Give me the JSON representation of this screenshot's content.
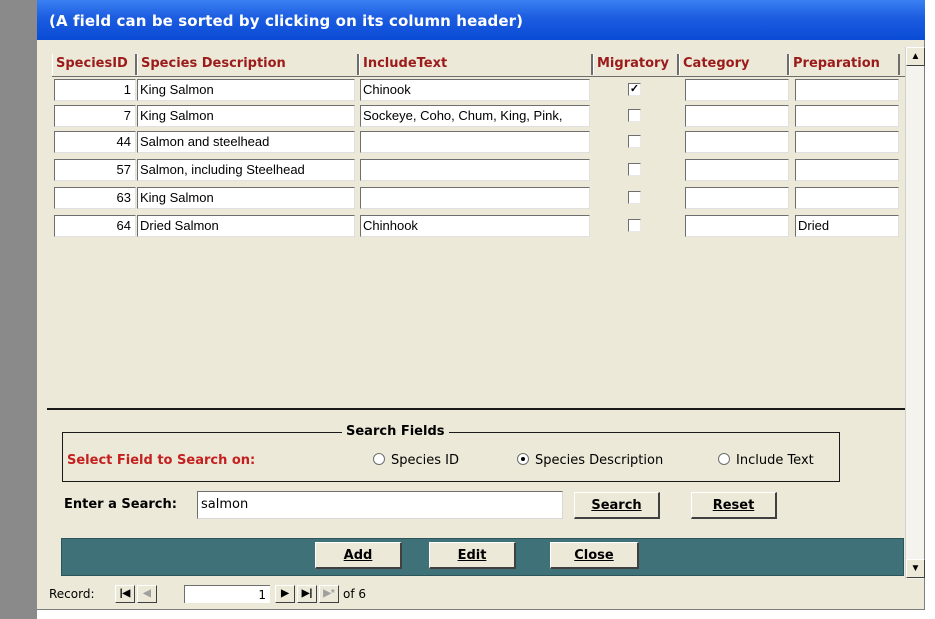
{
  "title": "(A field can be sorted by clicking on its column header)",
  "columns": [
    "SpeciesID",
    "Species Description",
    "IncludeText",
    "Migratory",
    "Category",
    "Preparation"
  ],
  "rows": [
    {
      "id": "1",
      "description": "King Salmon",
      "include": "Chinook",
      "migratory": true,
      "category": "",
      "preparation": ""
    },
    {
      "id": "7",
      "description": "King Salmon",
      "include": "Sockeye, Coho, Chum, King, Pink,",
      "migratory": false,
      "category": "",
      "preparation": ""
    },
    {
      "id": "44",
      "description": "Salmon and steelhead",
      "include": "",
      "migratory": false,
      "category": "",
      "preparation": ""
    },
    {
      "id": "57",
      "description": "Salmon, including Steelhead",
      "include": "",
      "migratory": false,
      "category": "",
      "preparation": ""
    },
    {
      "id": "63",
      "description": "King Salmon",
      "include": "",
      "migratory": false,
      "category": "",
      "preparation": ""
    },
    {
      "id": "64",
      "description": "Dried Salmon",
      "include": "Chinhook",
      "migratory": false,
      "category": "",
      "preparation": "Dried"
    }
  ],
  "search": {
    "legend": "Search Fields",
    "select_label": "Select Field to Search on:",
    "options": [
      {
        "label": "Species ID",
        "selected": false
      },
      {
        "label": "Species Description",
        "selected": true
      },
      {
        "label": "Include Text",
        "selected": false
      }
    ],
    "enter_label": "Enter a Search:",
    "value": "salmon",
    "search_button": "Search",
    "reset_button": "Reset"
  },
  "actions": {
    "add": "Add",
    "edit": "Edit",
    "close": "Close"
  },
  "record_nav": {
    "label": "Record:",
    "current": "1",
    "of_text": "of  6"
  },
  "colors": {
    "header_text": "#9b1b1b",
    "select_label": "#c42020",
    "teal_bar": "#3e7278",
    "title_bar": "#1c5ce0"
  }
}
